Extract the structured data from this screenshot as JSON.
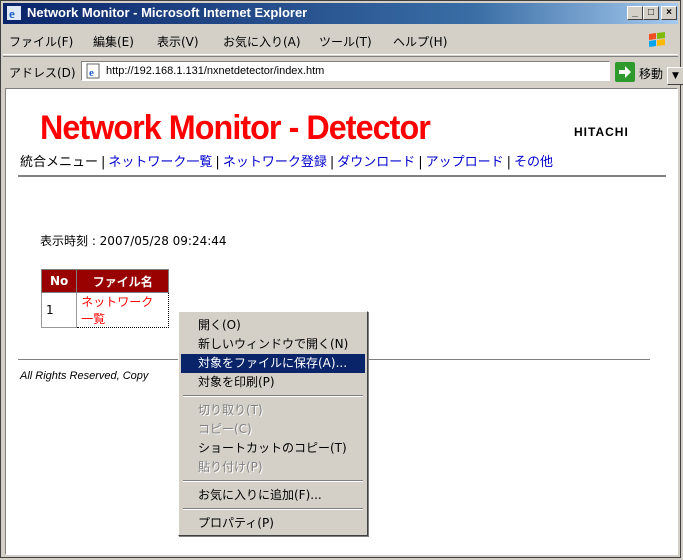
{
  "window": {
    "title": "Network Monitor - Microsoft Internet Explorer",
    "controls": {
      "minimize": "_",
      "maximize": "□",
      "close": "×"
    }
  },
  "menu": [
    "ファイル(F)",
    "編集(E)",
    "表示(V)",
    "お気に入り(A)",
    "ツール(T)",
    "ヘルプ(H)"
  ],
  "address": {
    "label": "アドレス(D)",
    "url": "http://192.168.1.131/nxnetdetector/index.htm",
    "go_label": "移動"
  },
  "page": {
    "logo": "Network Monitor - Detector",
    "brand": "HITACHI",
    "nav": {
      "current": "統合メニュー",
      "links": [
        "ネットワーク一覧",
        "ネットワーク登録",
        "ダウンロード",
        "アップロード",
        "その他"
      ]
    },
    "display_time": "表示時刻 : 2007/05/28 09:24:44",
    "table": {
      "headers": [
        "No",
        "ファイル名"
      ],
      "rows": [
        {
          "no": "1",
          "name": "ネットワーク一覧"
        }
      ]
    },
    "copyright": "All Rights Reserved, Copy"
  },
  "context_menu": {
    "items": [
      {
        "label": "開く(O)",
        "state": "normal"
      },
      {
        "label": "新しいウィンドウで開く(N)",
        "state": "normal"
      },
      {
        "label": "対象をファイルに保存(A)...",
        "state": "selected"
      },
      {
        "label": "対象を印刷(P)",
        "state": "normal"
      },
      {
        "label": "切り取り(T)",
        "state": "disabled"
      },
      {
        "label": "コピー(C)",
        "state": "disabled"
      },
      {
        "label": "ショートカットのコピー(T)",
        "state": "normal"
      },
      {
        "label": "貼り付け(P)",
        "state": "disabled"
      },
      {
        "label": "お気に入りに追加(F)...",
        "state": "normal"
      },
      {
        "label": "プロパティ(P)",
        "state": "normal"
      }
    ]
  },
  "colors": {
    "title_gradient_start": "#0a246a",
    "logo_red": "#ff0000",
    "header_dark_red": "#990000",
    "link_blue": "#0000cc",
    "menu_highlight": "#0a246a"
  }
}
